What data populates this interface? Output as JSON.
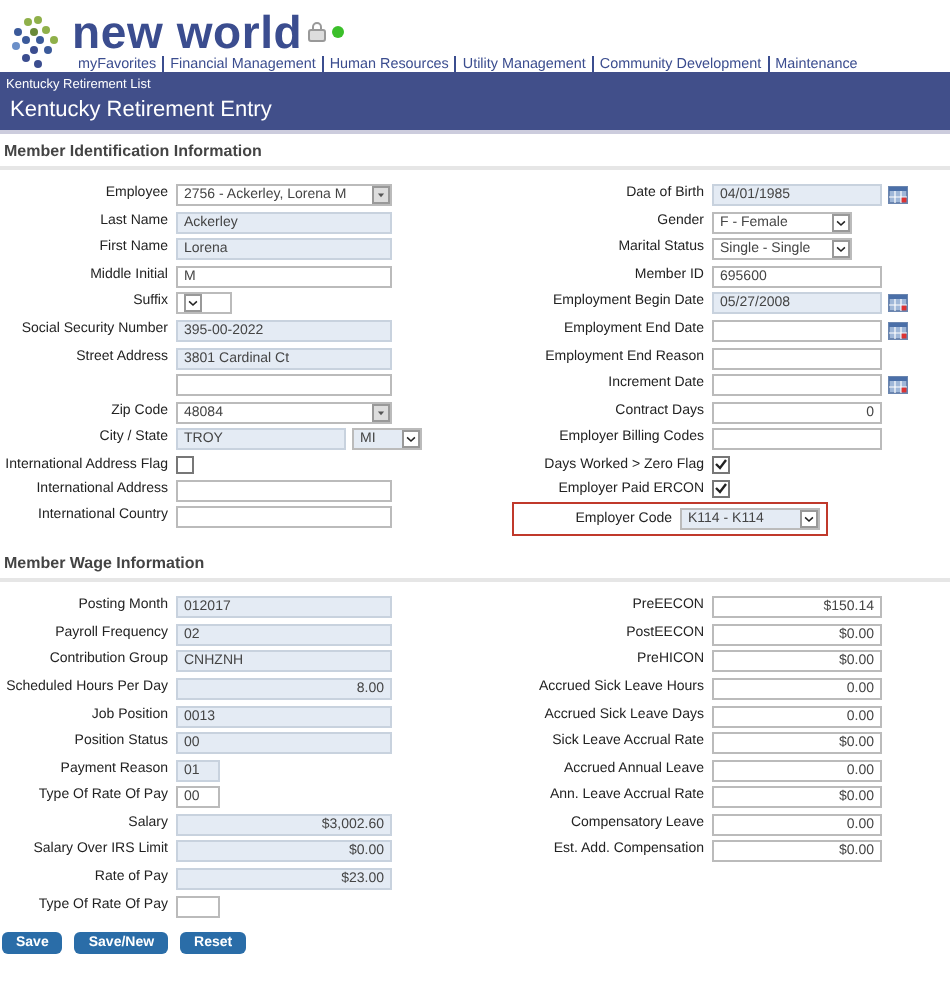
{
  "header": {
    "logo": "new world",
    "online": true,
    "nav": [
      "myFavorites",
      "Financial Management",
      "Human Resources",
      "Utility Management",
      "Community Development",
      "Maintenance"
    ]
  },
  "breadcrumb": "Kentucky Retirement List",
  "title": "Kentucky Retirement Entry",
  "sections": [
    {
      "title": "Member Identification Information",
      "left": [
        {
          "label": "Employee",
          "kind": "combo",
          "value": "2756 - Ackerley, Lorena M",
          "readonly": false
        },
        {
          "label": "Last Name",
          "kind": "text",
          "value": "Ackerley",
          "readonly": true
        },
        {
          "label": "First Name",
          "kind": "text",
          "value": "Lorena",
          "readonly": true
        },
        {
          "label": "Middle Initial",
          "kind": "text",
          "value": "M",
          "readonly": false
        },
        {
          "label": "Suffix",
          "kind": "tiny-select",
          "readonly": false
        },
        {
          "label": "Social Security Number",
          "kind": "text",
          "value": "395-00-2022",
          "readonly": true
        },
        {
          "label": "Street Address",
          "kind": "text",
          "value": "3801 Cardinal Ct",
          "readonly": true
        },
        {
          "kind": "text",
          "readonly": false
        },
        {
          "label": "Zip Code",
          "kind": "combo",
          "value": "48084",
          "readonly": false
        },
        {
          "label": "City / State",
          "kind": "city",
          "value": "TROY",
          "readonly": true,
          "extra": {
            "kind": "select",
            "value": "MI",
            "readonly": true
          }
        },
        {
          "label": "International Address Flag",
          "kind": "checkbox",
          "checked": false
        },
        {
          "label": "International Address",
          "kind": "text",
          "readonly": false
        },
        {
          "label": "International Country",
          "kind": "text",
          "readonly": false
        }
      ],
      "right": [
        {
          "label": "Date of Birth",
          "kind": "date",
          "value": "04/01/1985",
          "readonly": true
        },
        {
          "label": "Gender",
          "kind": "select",
          "value": "F - Female",
          "readonly": false
        },
        {
          "label": "Marital Status",
          "kind": "select",
          "value": "Single - Single",
          "readonly": false
        },
        {
          "label": "Member ID",
          "kind": "text",
          "value": "695600",
          "readonly": false
        },
        {
          "label": "Employment Begin Date",
          "kind": "date",
          "value": "05/27/2008",
          "readonly": true
        },
        {
          "label": "Employment End Date",
          "kind": "date",
          "readonly": false
        },
        {
          "label": "Employment End Reason",
          "kind": "text",
          "readonly": false
        },
        {
          "label": "Increment Date",
          "kind": "date",
          "readonly": false
        },
        {
          "label": "Contract Days",
          "kind": "number",
          "value": "0",
          "readonly": false
        },
        {
          "label": "Employer Billing Codes",
          "kind": "text",
          "readonly": false
        },
        {
          "label": "Days Worked > Zero Flag",
          "kind": "checkbox",
          "checked": true
        },
        {
          "label": "Employer Paid ERCON",
          "kind": "checkbox",
          "checked": true
        },
        {
          "label": "Employer Code",
          "kind": "select",
          "value": "K114 - K114",
          "readonly": true,
          "highlighted": true
        }
      ]
    },
    {
      "title": "Member Wage Information",
      "left": [
        {
          "label": "Posting Month",
          "kind": "text",
          "value": "012017",
          "readonly": true
        },
        {
          "label": "Payroll Frequency",
          "kind": "text",
          "value": "02",
          "readonly": true
        },
        {
          "label": "Contribution Group",
          "kind": "text",
          "value": "CNHZNH",
          "readonly": true
        },
        {
          "label": "Scheduled Hours Per Day",
          "kind": "number",
          "value": "8.00",
          "readonly": true
        },
        {
          "label": "Job Position",
          "kind": "text",
          "value": "0013",
          "readonly": true
        },
        {
          "label": "Position Status",
          "kind": "text",
          "value": "00",
          "readonly": true
        },
        {
          "label": "Payment Reason",
          "kind": "short",
          "value": "01",
          "readonly": true
        },
        {
          "label": "Type Of Rate Of Pay",
          "kind": "short",
          "value": "00",
          "readonly": false
        },
        {
          "label": "Salary",
          "kind": "number",
          "value": "$3,002.60",
          "readonly": true
        },
        {
          "label": "Salary Over IRS Limit",
          "kind": "number",
          "value": "$0.00",
          "readonly": true
        },
        {
          "label": "Rate of Pay",
          "kind": "number",
          "value": "$23.00",
          "readonly": true
        },
        {
          "label": "Type Of Rate Of Pay",
          "kind": "short",
          "readonly": false
        }
      ],
      "right": [
        {
          "label": "PreEECON",
          "kind": "number",
          "value": "$150.14",
          "readonly": false
        },
        {
          "label": "PostEECON",
          "kind": "number",
          "value": "$0.00",
          "readonly": false
        },
        {
          "label": "PreHICON",
          "kind": "number",
          "value": "$0.00",
          "readonly": false
        },
        {
          "label": "Accrued Sick Leave Hours",
          "kind": "number",
          "value": "0.00",
          "readonly": false
        },
        {
          "label": "Accrued Sick Leave Days",
          "kind": "number",
          "value": "0.00",
          "readonly": false
        },
        {
          "label": "Sick Leave Accrual Rate",
          "kind": "number",
          "value": "$0.00",
          "readonly": false
        },
        {
          "label": "Accrued Annual Leave",
          "kind": "number",
          "value": "0.00",
          "readonly": false
        },
        {
          "label": "Ann. Leave Accrual Rate",
          "kind": "number",
          "value": "$0.00",
          "readonly": false
        },
        {
          "label": "Compensatory Leave",
          "kind": "number",
          "value": "0.00",
          "readonly": false
        },
        {
          "label": "Est. Add. Compensation",
          "kind": "number",
          "value": "$0.00",
          "readonly": false
        }
      ]
    }
  ],
  "buttons": [
    "Save",
    "Save/New",
    "Reset"
  ]
}
